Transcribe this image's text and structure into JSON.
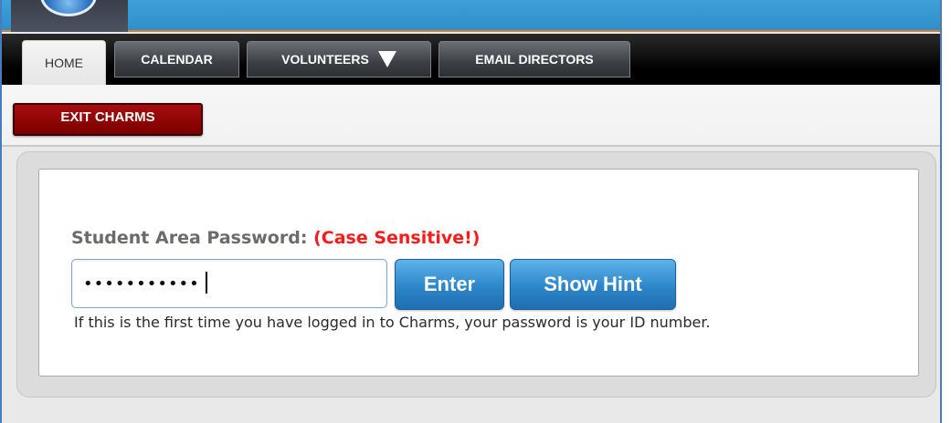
{
  "nav": {
    "tabs": [
      {
        "label": "HOME",
        "active": true
      },
      {
        "label": "CALENDAR",
        "active": false
      },
      {
        "label": "VOLUNTEERS",
        "active": false,
        "has_dropdown": true
      },
      {
        "label": "EMAIL DIRECTORS",
        "active": false
      }
    ]
  },
  "toolbar": {
    "exit_label": "EXIT CHARMS"
  },
  "login": {
    "label": "Student Area Password:",
    "warning": "(Case Sensitive!)",
    "password_value": "•••••••••••",
    "enter_label": "Enter",
    "hint_label": "Show Hint",
    "help_text": "If this is the first time you have logged in to Charms, your password is your ID number."
  },
  "colors": {
    "header_blue": "#3399d4",
    "exit_red": "#9a0606",
    "warning_red": "#ff1a1a",
    "button_blue": "#2c86c9"
  },
  "icons": {
    "logo": "globe-logo-icon",
    "dropdown": "triangle-down-icon"
  }
}
